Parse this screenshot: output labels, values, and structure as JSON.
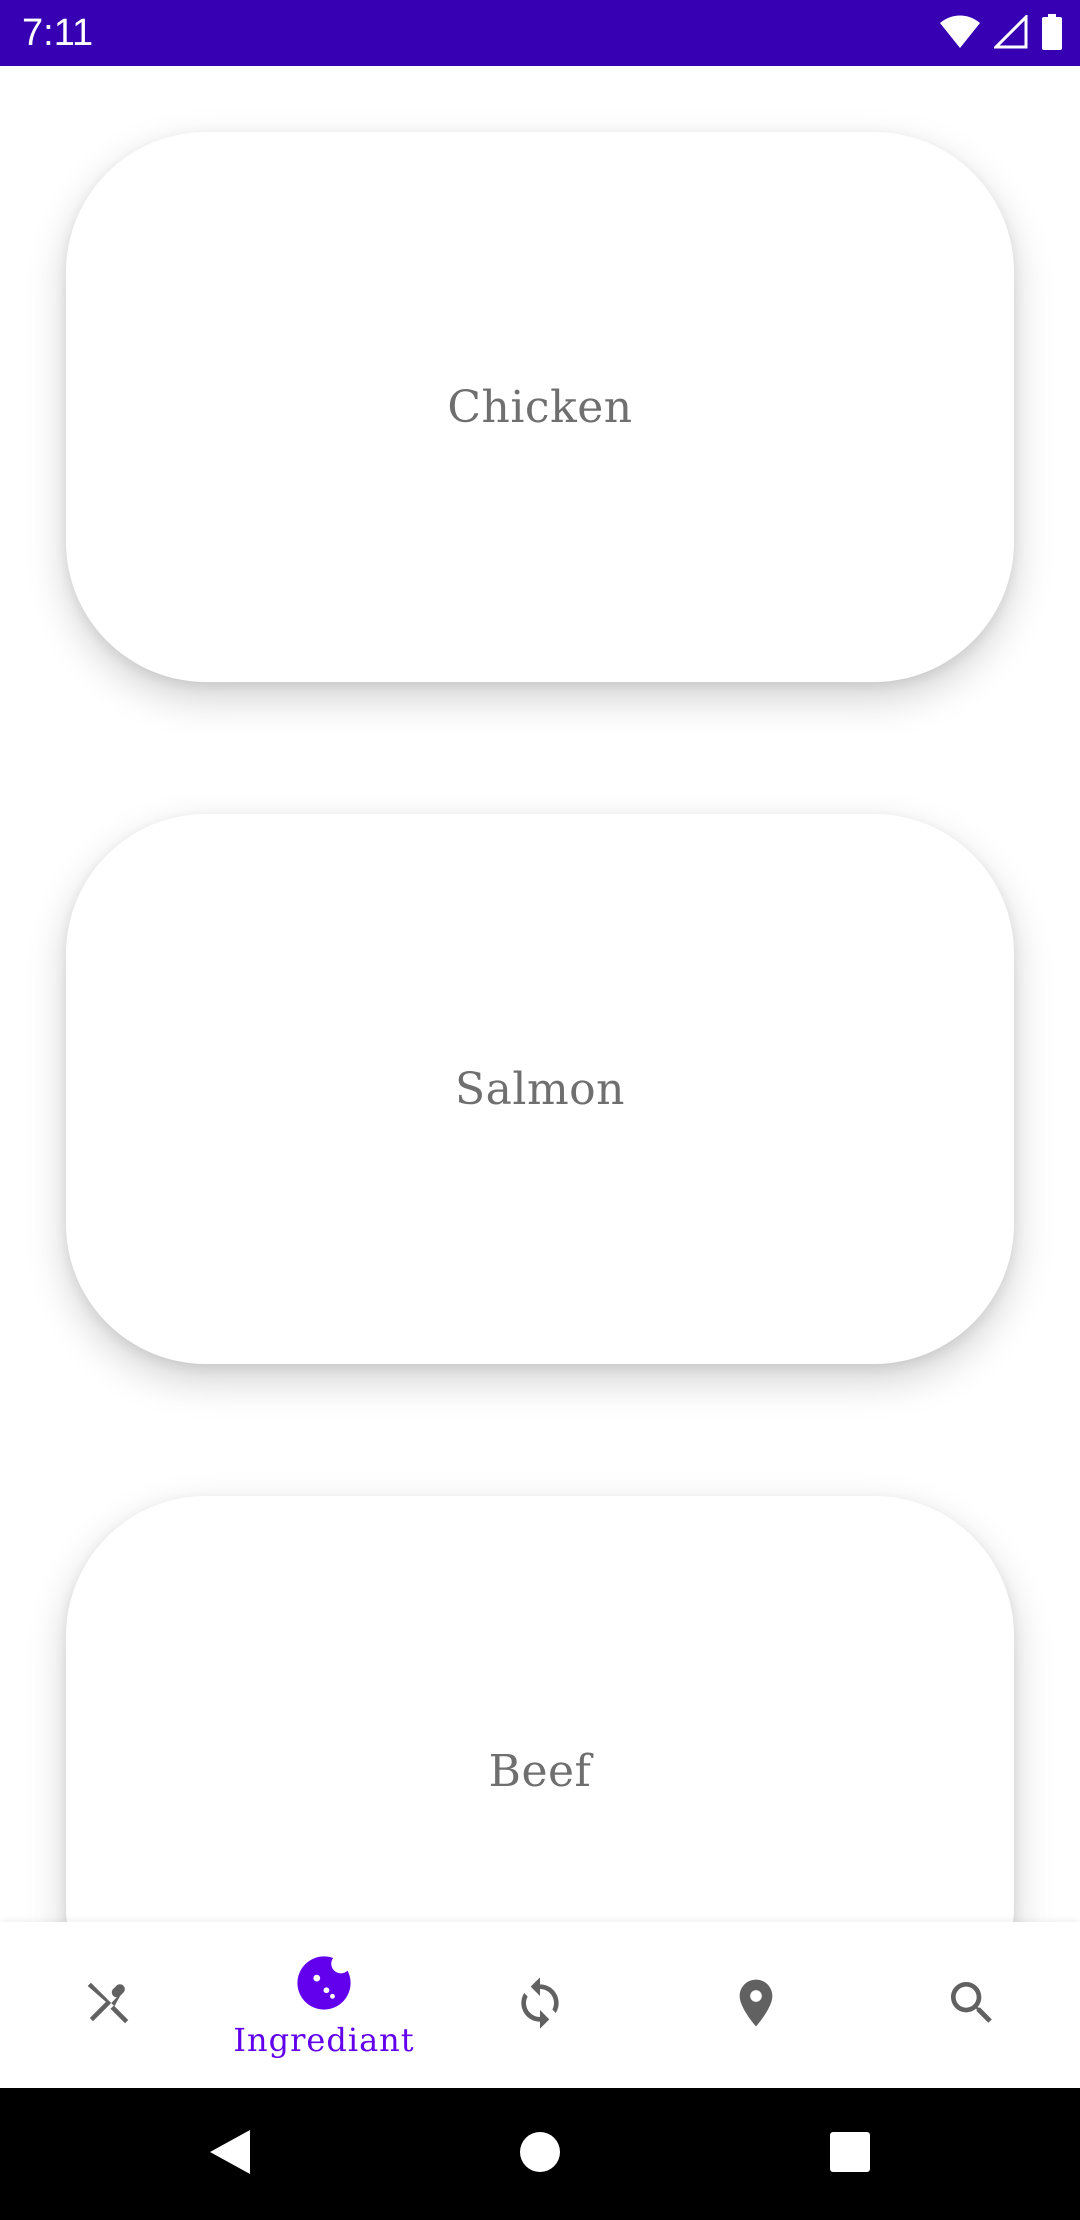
{
  "status_bar": {
    "time": "7:11",
    "background_color": "#3700b3",
    "icons": [
      "wifi-icon",
      "cellular-signal-icon",
      "battery-icon"
    ]
  },
  "cards": [
    {
      "label": "Chicken"
    },
    {
      "label": "Salmon"
    },
    {
      "label": "Beef"
    }
  ],
  "bottom_nav": {
    "active_color": "#6200ee",
    "inactive_color": "#616161",
    "items": [
      {
        "icon": "fork-spoon-crossed-icon",
        "label": "",
        "active": false
      },
      {
        "icon": "cookie-icon",
        "label": "Ingrediant",
        "active": true
      },
      {
        "icon": "refresh-icon",
        "label": "",
        "active": false
      },
      {
        "icon": "location-pin-icon",
        "label": "",
        "active": false
      },
      {
        "icon": "search-icon",
        "label": "",
        "active": false
      }
    ]
  },
  "system_nav": {
    "buttons": [
      "back-icon",
      "home-icon",
      "recents-icon"
    ]
  }
}
